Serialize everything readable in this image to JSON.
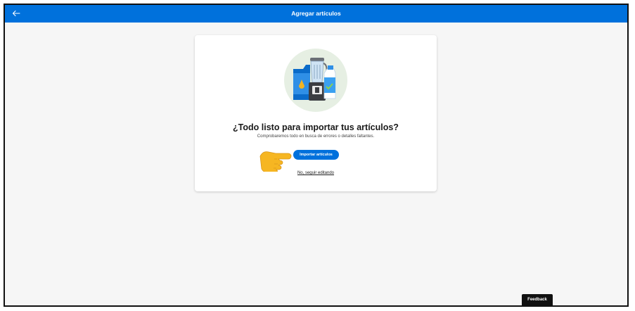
{
  "header": {
    "title": "Agregar artículos",
    "back_icon": "arrow-left-icon"
  },
  "card": {
    "illustration": "products-illustration",
    "heading": "¿Todo listo para importar tus artículos?",
    "subheading": "Comprobaremos todo en busca de errores o detalles faltantes.",
    "import_button": "Importar artículos",
    "continue_link": "No, seguir editando",
    "pointer_icon": "pointing-hand-icon"
  },
  "feedback_label": "Feedback",
  "colors": {
    "brand_blue": "#0071dc",
    "page_bg": "#f6f6f6",
    "hand_yellow": "#f6b622"
  }
}
